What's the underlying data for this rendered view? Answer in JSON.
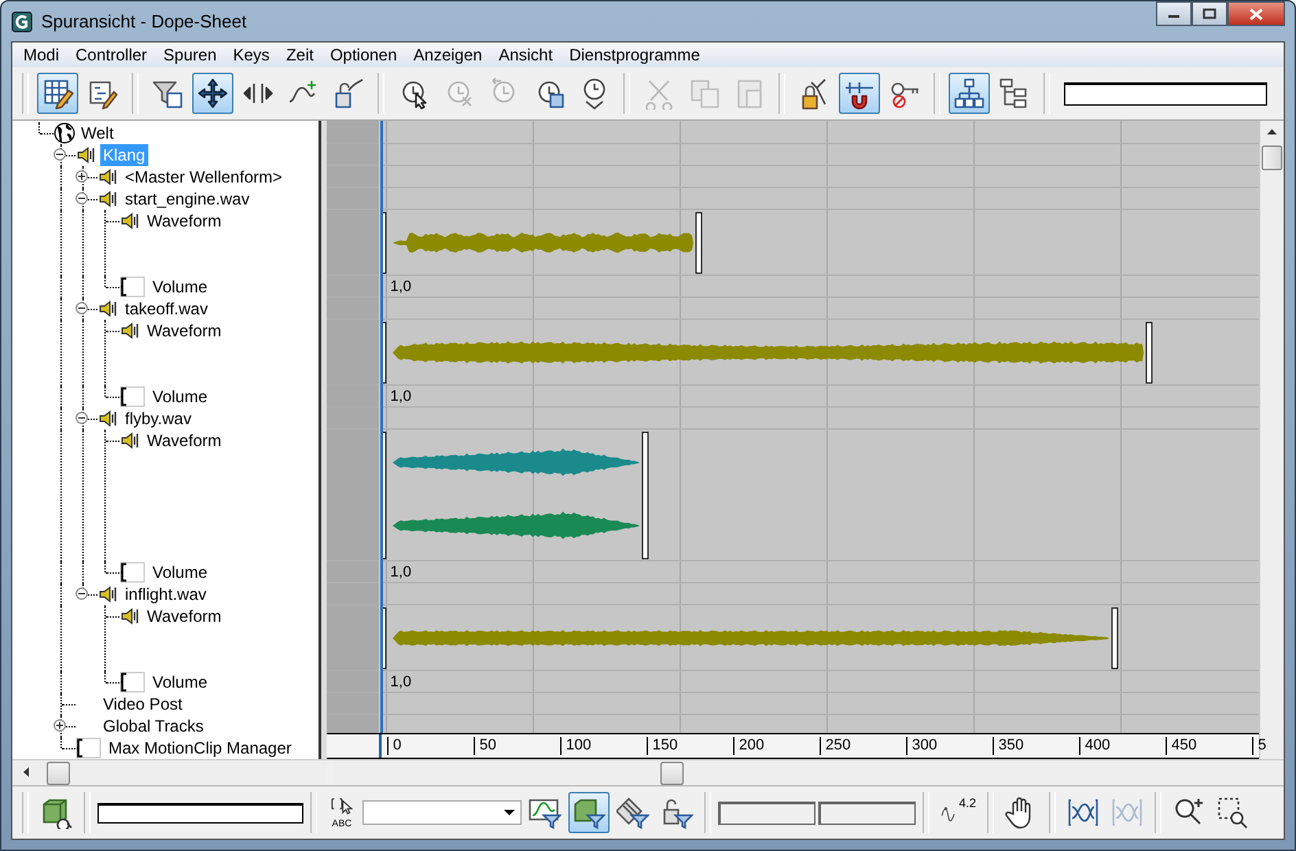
{
  "window": {
    "title": "Spuransicht - Dope-Sheet"
  },
  "menu": [
    "Modi",
    "Controller",
    "Spuren",
    "Keys",
    "Zeit",
    "Optionen",
    "Anzeigen",
    "Ansicht",
    "Dienstprogramme"
  ],
  "toolbar": [
    [
      {
        "selected": true,
        "disabled": false
      },
      {
        "selected": false,
        "disabled": false
      }
    ],
    [
      {
        "selected": false,
        "disabled": false
      },
      {
        "selected": true,
        "disabled": false
      },
      {
        "selected": false,
        "disabled": false
      },
      {
        "selected": false,
        "disabled": false
      },
      {
        "selected": false,
        "disabled": false
      }
    ],
    [
      {
        "selected": false,
        "disabled": false
      },
      {
        "selected": false,
        "disabled": true
      },
      {
        "selected": false,
        "disabled": true
      },
      {
        "selected": false,
        "disabled": false
      },
      {
        "selected": false,
        "disabled": false
      }
    ],
    [
      {
        "selected": false,
        "disabled": true
      },
      {
        "selected": false,
        "disabled": true
      },
      {
        "selected": false,
        "disabled": true
      }
    ],
    [
      {
        "selected": false,
        "disabled": false
      },
      {
        "selected": true,
        "disabled": false
      },
      {
        "selected": false,
        "disabled": false
      }
    ],
    [
      {
        "selected": true,
        "disabled": false
      },
      {
        "selected": false,
        "disabled": false
      }
    ]
  ],
  "tree": [
    {
      "label": "Welt",
      "kind": "globe",
      "selected": false,
      "children": [
        {
          "label": "Klang",
          "kind": "speaker",
          "selected": true,
          "expanded": true,
          "children": [
            {
              "label": "<Master Wellenform>",
              "kind": "speaker",
              "selected": false,
              "expanded": false
            },
            {
              "label": "start_engine.wav",
              "kind": "speaker",
              "selected": false,
              "expanded": true,
              "children": [
                {
                  "label": "Waveform",
                  "kind": "waveform",
                  "selected": false,
                  "color": "#8c8a00"
                },
                {
                  "label": "Volume",
                  "kind": "volume",
                  "selected": false,
                  "value": "1,0"
                }
              ]
            },
            {
              "label": "takeoff.wav",
              "kind": "speaker",
              "selected": false,
              "expanded": true,
              "children": [
                {
                  "label": "Waveform",
                  "kind": "waveform",
                  "selected": false,
                  "color": "#8c8a00"
                },
                {
                  "label": "Volume",
                  "kind": "volume",
                  "selected": false,
                  "value": "1,0"
                }
              ]
            },
            {
              "label": "flyby.wav",
              "kind": "speaker",
              "selected": false,
              "expanded": true,
              "children": [
                {
                  "label": "Waveform",
                  "kind": "stereo",
                  "selected": false,
                  "channels": [
                    {
                      "color": "#1a8a8c"
                    },
                    {
                      "color": "#1a8a55"
                    }
                  ]
                },
                {
                  "label": "Volume",
                  "kind": "volume",
                  "selected": false,
                  "value": "1,0"
                }
              ]
            },
            {
              "label": "inflight.wav",
              "kind": "speaker",
              "selected": false,
              "expanded": true,
              "children": [
                {
                  "label": "Waveform",
                  "kind": "waveform",
                  "selected": false,
                  "color": "#8c8a00"
                },
                {
                  "label": "Volume",
                  "kind": "volume",
                  "selected": false,
                  "value": "1,0"
                }
              ]
            }
          ]
        },
        {
          "label": "Video Post",
          "kind": "plain",
          "selected": false
        },
        {
          "label": "Global Tracks",
          "kind": "plain",
          "selected": false,
          "expanded": false
        },
        {
          "label": "Max MotionClip Manager",
          "kind": "volume",
          "selected": false
        }
      ]
    }
  ],
  "ruler": [
    "0",
    "50",
    "100",
    "150",
    "200",
    "250",
    "300",
    "350",
    "400",
    "450",
    "5"
  ],
  "bottom": {
    "abc": "ABC",
    "filters": [
      {
        "selected": false
      },
      {
        "selected": true
      },
      {
        "selected": false
      },
      {
        "selected": false
      }
    ],
    "value_icon": "4.2",
    "zoom": [
      {
        "disabled": false
      },
      {
        "disabled": true
      }
    ]
  }
}
